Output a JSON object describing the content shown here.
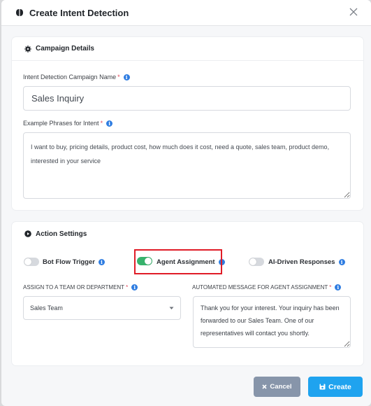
{
  "modal": {
    "title": "Create Intent Detection",
    "close_icon": "close-icon",
    "title_icon": "brain-icon"
  },
  "campaign": {
    "section_title": "Campaign Details",
    "section_icon": "gear-icon",
    "name_label": "Intent Detection Campaign Name",
    "name_required": "*",
    "name_value": "Sales Inquiry",
    "phrases_label": "Example Phrases for Intent",
    "phrases_required": "*",
    "phrases_value": "I want to buy, pricing details, product cost, how much does it cost, need a quote, sales team, product demo, interested in your service"
  },
  "action": {
    "section_title": "Action Settings",
    "section_icon": "play-circle-icon",
    "toggles": [
      {
        "label": "Bot Flow Trigger",
        "on": false
      },
      {
        "label": "Agent Assignment",
        "on": true
      },
      {
        "label": "AI-Driven Responses",
        "on": false
      }
    ],
    "assign_label": "ASSIGN TO A TEAM OR DEPARTMENT",
    "assign_required": "*",
    "assign_value": "Sales Team",
    "message_label": "AUTOMATED MESSAGE FOR AGENT ASSIGNMENT",
    "message_required": "*",
    "message_value": "Thank you for your interest. Your inquiry has been forwarded to our Sales Team. One of our representatives will contact you shortly."
  },
  "footer": {
    "cancel_label": "Cancel",
    "create_label": "Create"
  },
  "colors": {
    "accent": "#2f7de1",
    "toggle_on": "#37b26c",
    "toggle_off": "#d6d9de",
    "cancel_bg": "#8795aa",
    "create_bg": "#1fa3ef",
    "highlight": "#e01c27"
  }
}
